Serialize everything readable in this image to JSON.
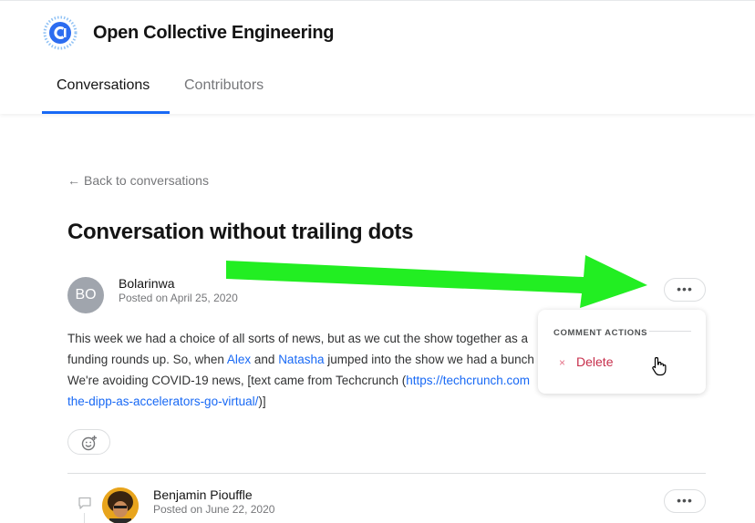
{
  "header": {
    "collective_name": "Open Collective Engineering",
    "tabs": [
      {
        "label": "Conversations",
        "active": true
      },
      {
        "label": "Contributors",
        "active": false
      }
    ]
  },
  "conversation": {
    "back_link": "Back to conversations",
    "title": "Conversation without trailing dots",
    "author": {
      "initials": "BO",
      "name": "Bolarinwa",
      "posted": "Posted on April 25, 2020"
    },
    "body": {
      "line1": "This week we had a choice of all sorts of news, but as we cut the show together as a",
      "line2_start": "funding rounds up. So, when ",
      "link_alex": "Alex",
      "line2_and": " and ",
      "link_natasha": "Natasha",
      "line2_end": " jumped into the show we had a bunch",
      "line3_start": "We're avoiding COVID-19 news, [text came from Techcrunch (",
      "link_url_part1": "https://techcrunch.com",
      "link_url_part2": "the-dipp-as-accelerators-go-virtual/",
      "line4_end": ")]"
    },
    "more_label": "•••"
  },
  "comment_actions": {
    "title": "COMMENT ACTIONS",
    "delete_label": "Delete",
    "delete_icon": "×"
  },
  "reply": {
    "author_name": "Benjamin Piouffle",
    "posted": "Posted on June 22, 2020",
    "more_label": "•••"
  },
  "colors": {
    "accent": "#1869f5",
    "danger": "#c72e4b",
    "annotation_arrow": "#22ee22"
  }
}
